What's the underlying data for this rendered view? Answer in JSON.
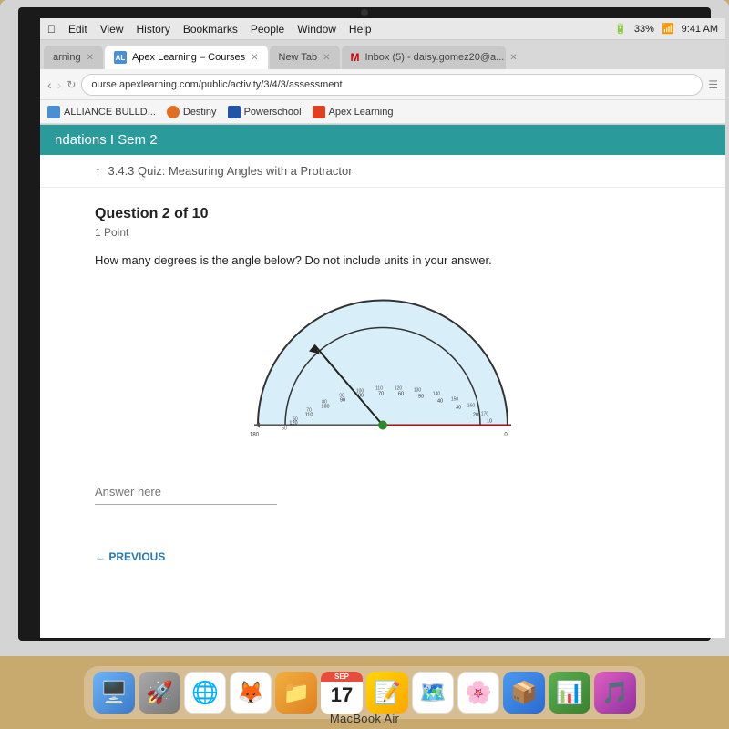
{
  "laptop": {
    "model": "MacBook Air"
  },
  "menu_bar": {
    "items": [
      "Edit",
      "View",
      "History",
      "Bookmarks",
      "People",
      "Window",
      "Help"
    ],
    "battery": "33%",
    "wifi": "wifi"
  },
  "browser": {
    "tabs": [
      {
        "label": "arning",
        "active": false,
        "favicon": ""
      },
      {
        "label": "Apex Learning – Courses",
        "active": true,
        "favicon": "AL"
      },
      {
        "label": "New Tab",
        "active": false,
        "favicon": ""
      },
      {
        "label": "M Inbox (5) - daisy.gomez20@a...",
        "active": false,
        "favicon": "M"
      }
    ],
    "address": "ourse.apexlearning.com/public/activity/3/4/3/assessment",
    "bookmarks": [
      {
        "label": "ALLIANCE BULLD...",
        "color": "#4a8fd4"
      },
      {
        "label": "Destiny",
        "color": "#e07020"
      },
      {
        "label": "Powerschool",
        "color": "#2255aa"
      },
      {
        "label": "Apex Learning",
        "color": "#e04020"
      }
    ]
  },
  "page": {
    "course_header": "ndations I Sem 2",
    "quiz_label": "3.4.3 Quiz:  Measuring Angles with a Protractor",
    "question_number": "Question 2 of 10",
    "points": "1 Point",
    "question_text": "How many degrees is the angle below? Do not include units in your answer.",
    "answer_placeholder": "Answer here",
    "prev_label": "← PREVIOUS"
  },
  "dock": {
    "date_month": "SEP",
    "date_day": "17",
    "icons": [
      "🍎",
      "🚀",
      "🌐",
      "🦊",
      "📁",
      "📷",
      "🗺️",
      "🖼️",
      "📊",
      "🎵"
    ]
  }
}
